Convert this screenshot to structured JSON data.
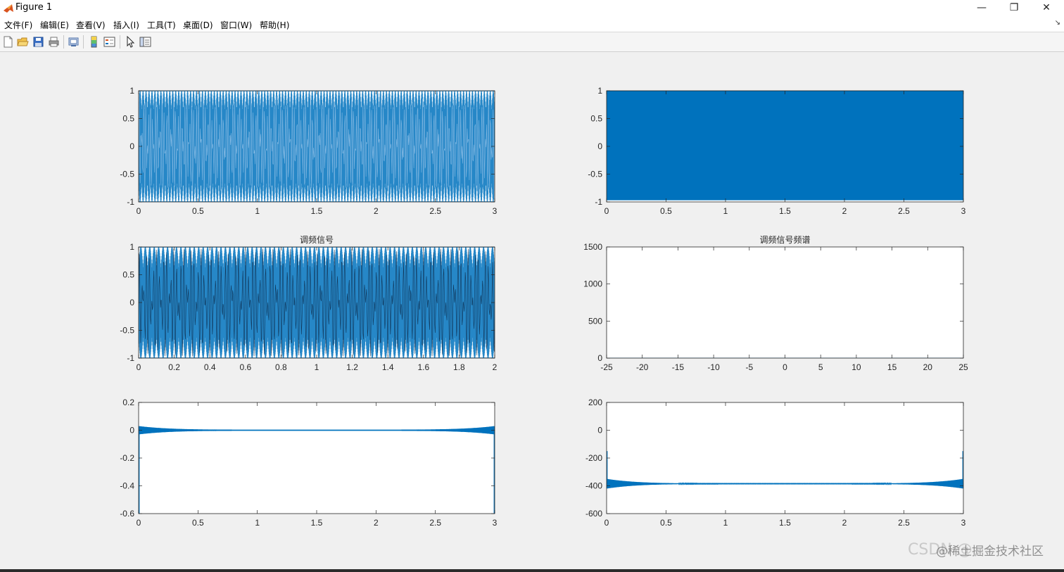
{
  "window": {
    "title": "Figure 1",
    "minimize_glyph": "—",
    "maximize_glyph": "❐",
    "close_glyph": "✕"
  },
  "menu": {
    "items": [
      "文件(F)",
      "编辑(E)",
      "查看(V)",
      "插入(I)",
      "工具(T)",
      "桌面(D)",
      "窗口(W)",
      "帮助(H)"
    ],
    "overflow_glyph": "↘"
  },
  "toolbar": {
    "icons": [
      "new-figure-icon",
      "open-file-icon",
      "save-icon",
      "print-icon",
      "print-preview-icon",
      "colorbar-icon",
      "legend-icon",
      "pointer-icon",
      "property-inspector-icon"
    ]
  },
  "colors": {
    "line": "#0072bd",
    "axes_bg": "#ffffff",
    "figure_bg": "#f0f0f0"
  },
  "watermark": {
    "text1": "CSDN @",
    "text2": "@稀土掘金技术社区"
  },
  "chart_data": [
    {
      "type": "line",
      "title": "",
      "xlabel": "",
      "ylabel": "",
      "xlim": [
        0,
        3
      ],
      "ylim": [
        -1,
        1
      ],
      "xticks": [
        "0",
        "0.5",
        "1",
        "1.5",
        "2",
        "2.5",
        "3"
      ],
      "yticks": [
        "-1",
        "-0.5",
        "0",
        "0.5",
        "1"
      ],
      "series": [
        {
          "kind": "dense-oscillation",
          "amplitude": 1,
          "beat_count": 60
        }
      ]
    },
    {
      "type": "line",
      "title": "",
      "xlabel": "",
      "ylabel": "",
      "xlim": [
        0,
        3
      ],
      "ylim": [
        -1,
        1
      ],
      "xticks": [
        "0",
        "0.5",
        "1",
        "1.5",
        "2",
        "2.5",
        "3"
      ],
      "yticks": [
        "-1",
        "-0.5",
        "0",
        "0.5",
        "1"
      ],
      "series": [
        {
          "kind": "filled-band",
          "ymin": -0.97,
          "ymax": 1
        }
      ]
    },
    {
      "type": "line",
      "title": "调频信号",
      "xlabel": "",
      "ylabel": "",
      "xlim": [
        0,
        2
      ],
      "ylim": [
        -1,
        1
      ],
      "xticks": [
        "0",
        "0.2",
        "0.4",
        "0.6",
        "0.8",
        "1",
        "1.2",
        "1.4",
        "1.6",
        "1.8",
        "2"
      ],
      "yticks": [
        "-1",
        "-0.5",
        "0",
        "0.5",
        "1"
      ],
      "series": [
        {
          "kind": "fm-signal",
          "amplitude": 1,
          "beat_count": 40
        }
      ]
    },
    {
      "type": "line",
      "title": "调频信号频谱",
      "xlabel": "",
      "ylabel": "",
      "xlim": [
        -25,
        25
      ],
      "ylim": [
        0,
        1500
      ],
      "xticks": [
        "-25",
        "-20",
        "-15",
        "-10",
        "-5",
        "0",
        "5",
        "10",
        "15",
        "20",
        "25"
      ],
      "yticks": [
        "0",
        "500",
        "1000",
        "1500"
      ],
      "series": [
        {
          "kind": "flat",
          "value": 0
        }
      ]
    },
    {
      "type": "line",
      "title": "",
      "xlabel": "",
      "ylabel": "",
      "xlim": [
        0,
        3
      ],
      "ylim": [
        -0.6,
        0.2
      ],
      "xticks": [
        "0",
        "0.5",
        "1",
        "1.5",
        "2",
        "2.5",
        "3"
      ],
      "yticks": [
        "-0.6",
        "-0.4",
        "-0.2",
        "0",
        "0.2"
      ],
      "series": [
        {
          "kind": "edge-noise",
          "center": 0,
          "amp_edge": 0.03,
          "amp_mid": 0.004,
          "edge_spike": -0.6
        }
      ]
    },
    {
      "type": "line",
      "title": "",
      "xlabel": "",
      "ylabel": "",
      "xlim": [
        0,
        3
      ],
      "ylim": [
        -600,
        200
      ],
      "xticks": [
        "0",
        "0.5",
        "1",
        "1.5",
        "2",
        "2.5",
        "3"
      ],
      "yticks": [
        "-600",
        "-400",
        "-200",
        "0",
        "200"
      ],
      "series": [
        {
          "kind": "edge-noise",
          "center": -385,
          "amp_edge": 35,
          "amp_mid": 2,
          "edge_spike": -150
        }
      ]
    }
  ]
}
